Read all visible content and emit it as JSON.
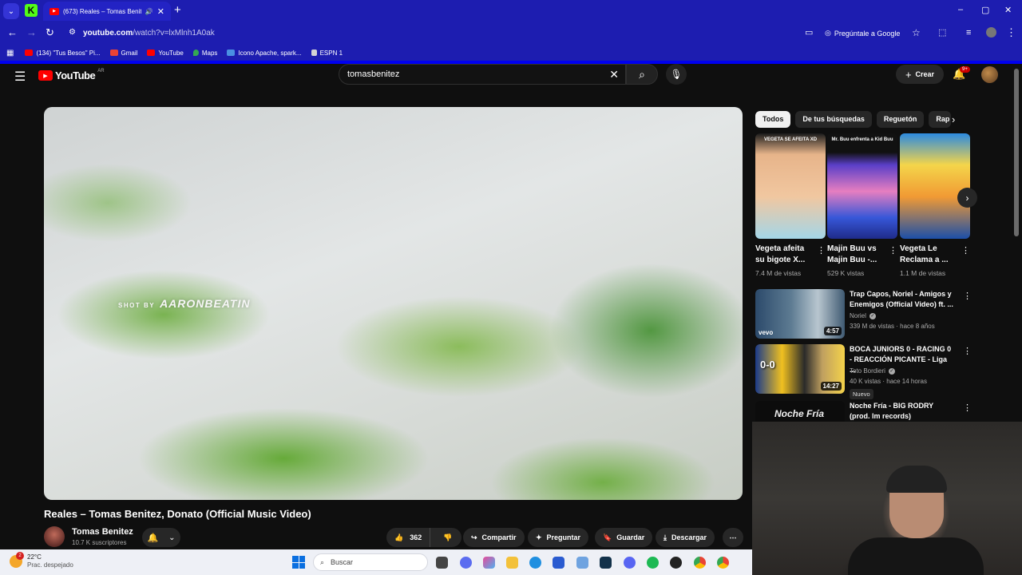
{
  "browser": {
    "tab_title": "(673) Reales – Tomas Benite",
    "tab_icon": "youtube-favicon",
    "new_tab": "+",
    "window_controls": [
      "–",
      "▢",
      "✕"
    ],
    "url_host": "youtube.com",
    "url_path": "/watch?v=lxMlnh1A0ak",
    "ask_google": "Pregúntale a Google",
    "bookmarks": [
      {
        "label": "(134) \"Tus Besos\" Pi...",
        "color": "#ff0000"
      },
      {
        "label": "Gmail",
        "color": "#ea4335"
      },
      {
        "label": "YouTube",
        "color": "#ff0000"
      },
      {
        "label": "Maps",
        "color": "#34a853"
      },
      {
        "label": "Icono Apache, spark...",
        "color": "#4a90e2"
      },
      {
        "label": "ESPN 1",
        "color": "#d4d4d4"
      }
    ]
  },
  "youtube": {
    "logo_text": "YouTube",
    "logo_region": "AR",
    "search_value": "tomasbenitez",
    "create_label": "Crear",
    "notif_badge": "9+"
  },
  "video": {
    "watermark_small": "SHOT BY",
    "watermark_big": "AARONBEATIN",
    "title": "Reales – Tomas Benitez, Donato (Official Music Video)",
    "channel": "Tomas Benitez",
    "subscribers": "10.7 K suscriptores",
    "likes": "362",
    "share": "Compartir",
    "ask": "Preguntar",
    "save": "Guardar",
    "download": "Descargar"
  },
  "sidebar": {
    "chips": [
      "Todos",
      "De tus búsquedas",
      "Reguetón",
      "Rap"
    ],
    "shorts": [
      {
        "caption": "VEGETA SE AFEITA XD",
        "title": "Vegeta afeita su bigote X...",
        "views": "7.4 M de vistas"
      },
      {
        "caption": "Mr. Buu enfrenta a Kid Buu",
        "title": "Majin Buu vs Majin Buu -...",
        "views": "529 K vistas"
      },
      {
        "caption": "",
        "title": "Vegeta Le Reclama a ...",
        "views": "1.1 M de vistas"
      }
    ],
    "recommended": [
      {
        "title": "Trap Capos, Noriel - Amigos y Enemigos (Official Video) ft. ...",
        "channel": "Noriel",
        "meta": "339 M de vistas · hace 8 años",
        "duration": "4:57",
        "thumb_text": "vevo",
        "badge": ""
      },
      {
        "title": "BOCA JUNIORS 0 - RACING 0 - REACCIÓN PICANTE - Liga ...",
        "channel": "Toto Bordieri",
        "meta": "40 K vistas · hace 14 horas",
        "duration": "14:27",
        "thumb_text": "0-0",
        "badge": "Nuevo"
      },
      {
        "title": "Noche Fría - BIG RODRY (prod. lm records)",
        "channel": "",
        "meta": "",
        "duration": "",
        "thumb_text": "Noche Fría",
        "badge": ""
      }
    ]
  },
  "taskbar": {
    "temperature": "22°C",
    "weather": "Prac. despejado",
    "weather_badge": "2",
    "search_placeholder": "Buscar"
  }
}
